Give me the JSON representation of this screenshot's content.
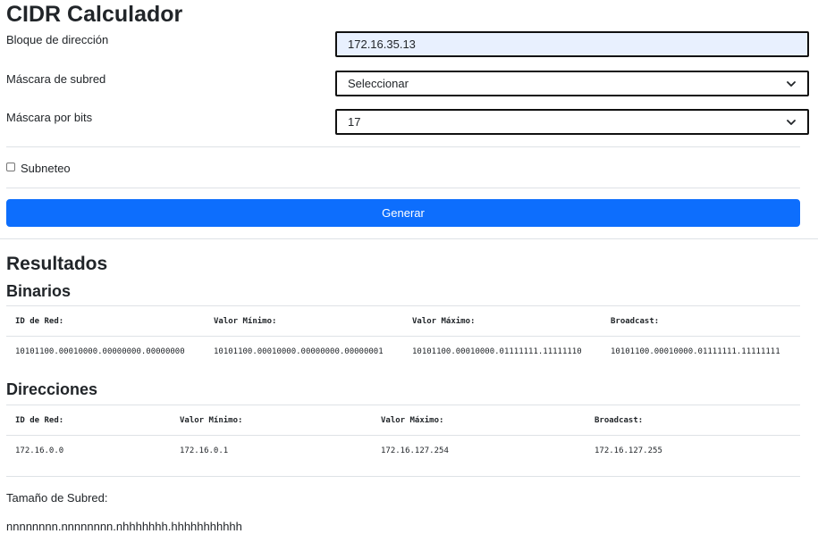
{
  "app": {
    "title": "CIDR Calculador"
  },
  "form": {
    "address_label": "Bloque de dirección",
    "address_value": "172.16.35.13",
    "subnet_mask_label": "Máscara de subred",
    "subnet_mask_selected": "Seleccionar",
    "bits_mask_label": "Máscara por bits",
    "bits_mask_selected": "17",
    "subnetting_label": "Subneteo",
    "subnetting_checked": false,
    "generate_label": "Generar"
  },
  "results": {
    "title": "Resultados",
    "binary": {
      "title": "Binarios",
      "headers": [
        "ID de Red:",
        "Valor Mínimo:",
        "Valor Máximo:",
        "Broadcast:"
      ],
      "values": [
        "10101100.00010000.00000000.00000000",
        "10101100.00010000.00000000.00000001",
        "10101100.00010000.01111111.11111110",
        "10101100.00010000.01111111.11111111"
      ]
    },
    "addresses": {
      "title": "Direcciones",
      "headers": [
        "ID de Red:",
        "Valor Mínimo:",
        "Valor Máximo:",
        "Broadcast:"
      ],
      "values": [
        "172.16.0.0",
        "172.16.0.1",
        "172.16.127.254",
        "172.16.127.255"
      ]
    },
    "subnet_size_label": "Tamaño de Subred:",
    "subnet_size_value": "nnnnnnnn.nnnnnnnn.nhhhhhhh.hhhhhhhhhhh"
  },
  "icons": {
    "dropdown": "chevron-down-icon"
  },
  "colors": {
    "accent": "#0d6efd",
    "input_bg": "#e8f0fe",
    "divider": "#dee2e6"
  }
}
